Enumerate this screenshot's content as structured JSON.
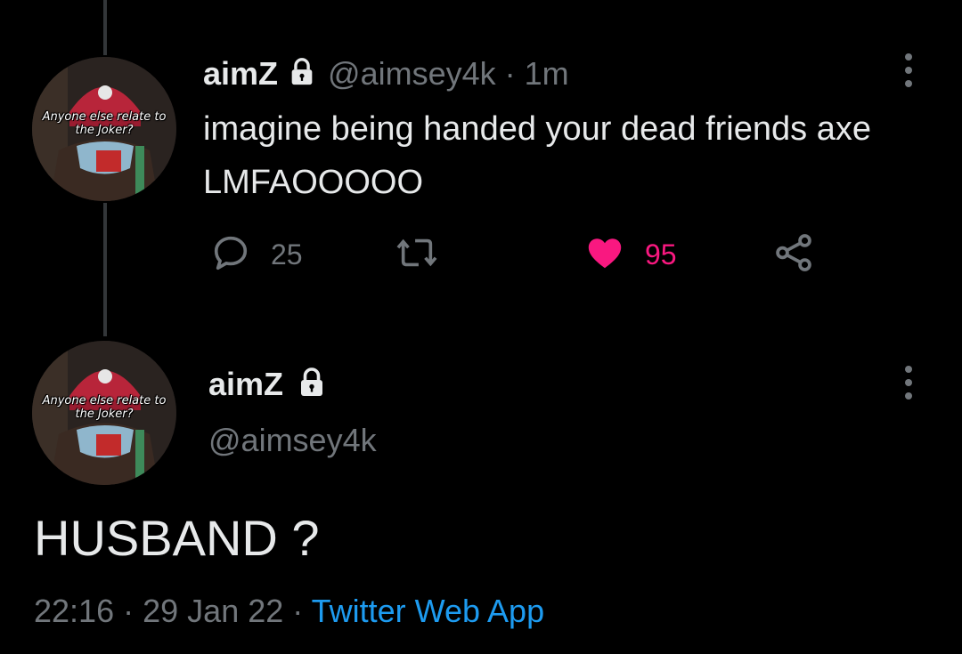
{
  "tweet1": {
    "display_name": "aimZ",
    "handle": "@aimsey4k",
    "separator": "·",
    "time": "1m",
    "text": "imagine being handed your dead friends axe LMFAOOOOO",
    "avatar_caption_line1": "Anyone else relate to",
    "avatar_caption_line2": "the Joker?",
    "actions": {
      "reply_count": "25",
      "retweet_count": "",
      "like_count": "95",
      "liked": true
    }
  },
  "tweet2": {
    "display_name": "aimZ",
    "handle": "@aimsey4k",
    "avatar_caption_line1": "Anyone else relate to",
    "avatar_caption_line2": "the Joker?",
    "text": "HUSBAND ?",
    "meta": {
      "time": "22:16",
      "sep1": "·",
      "date": "29 Jan 22",
      "sep2": "·",
      "app": "Twitter Web App"
    }
  },
  "colors": {
    "background": "#000000",
    "text_primary": "#e7e9ea",
    "text_secondary": "#71767b",
    "like_pink": "#f91880",
    "link_blue": "#1d9bf0",
    "thread_line": "#333639"
  },
  "icons": {
    "lock": "lock-icon",
    "more": "more-vertical-icon",
    "reply": "reply-bubble-icon",
    "retweet": "retweet-icon",
    "like": "heart-filled-icon",
    "share": "share-icon"
  }
}
